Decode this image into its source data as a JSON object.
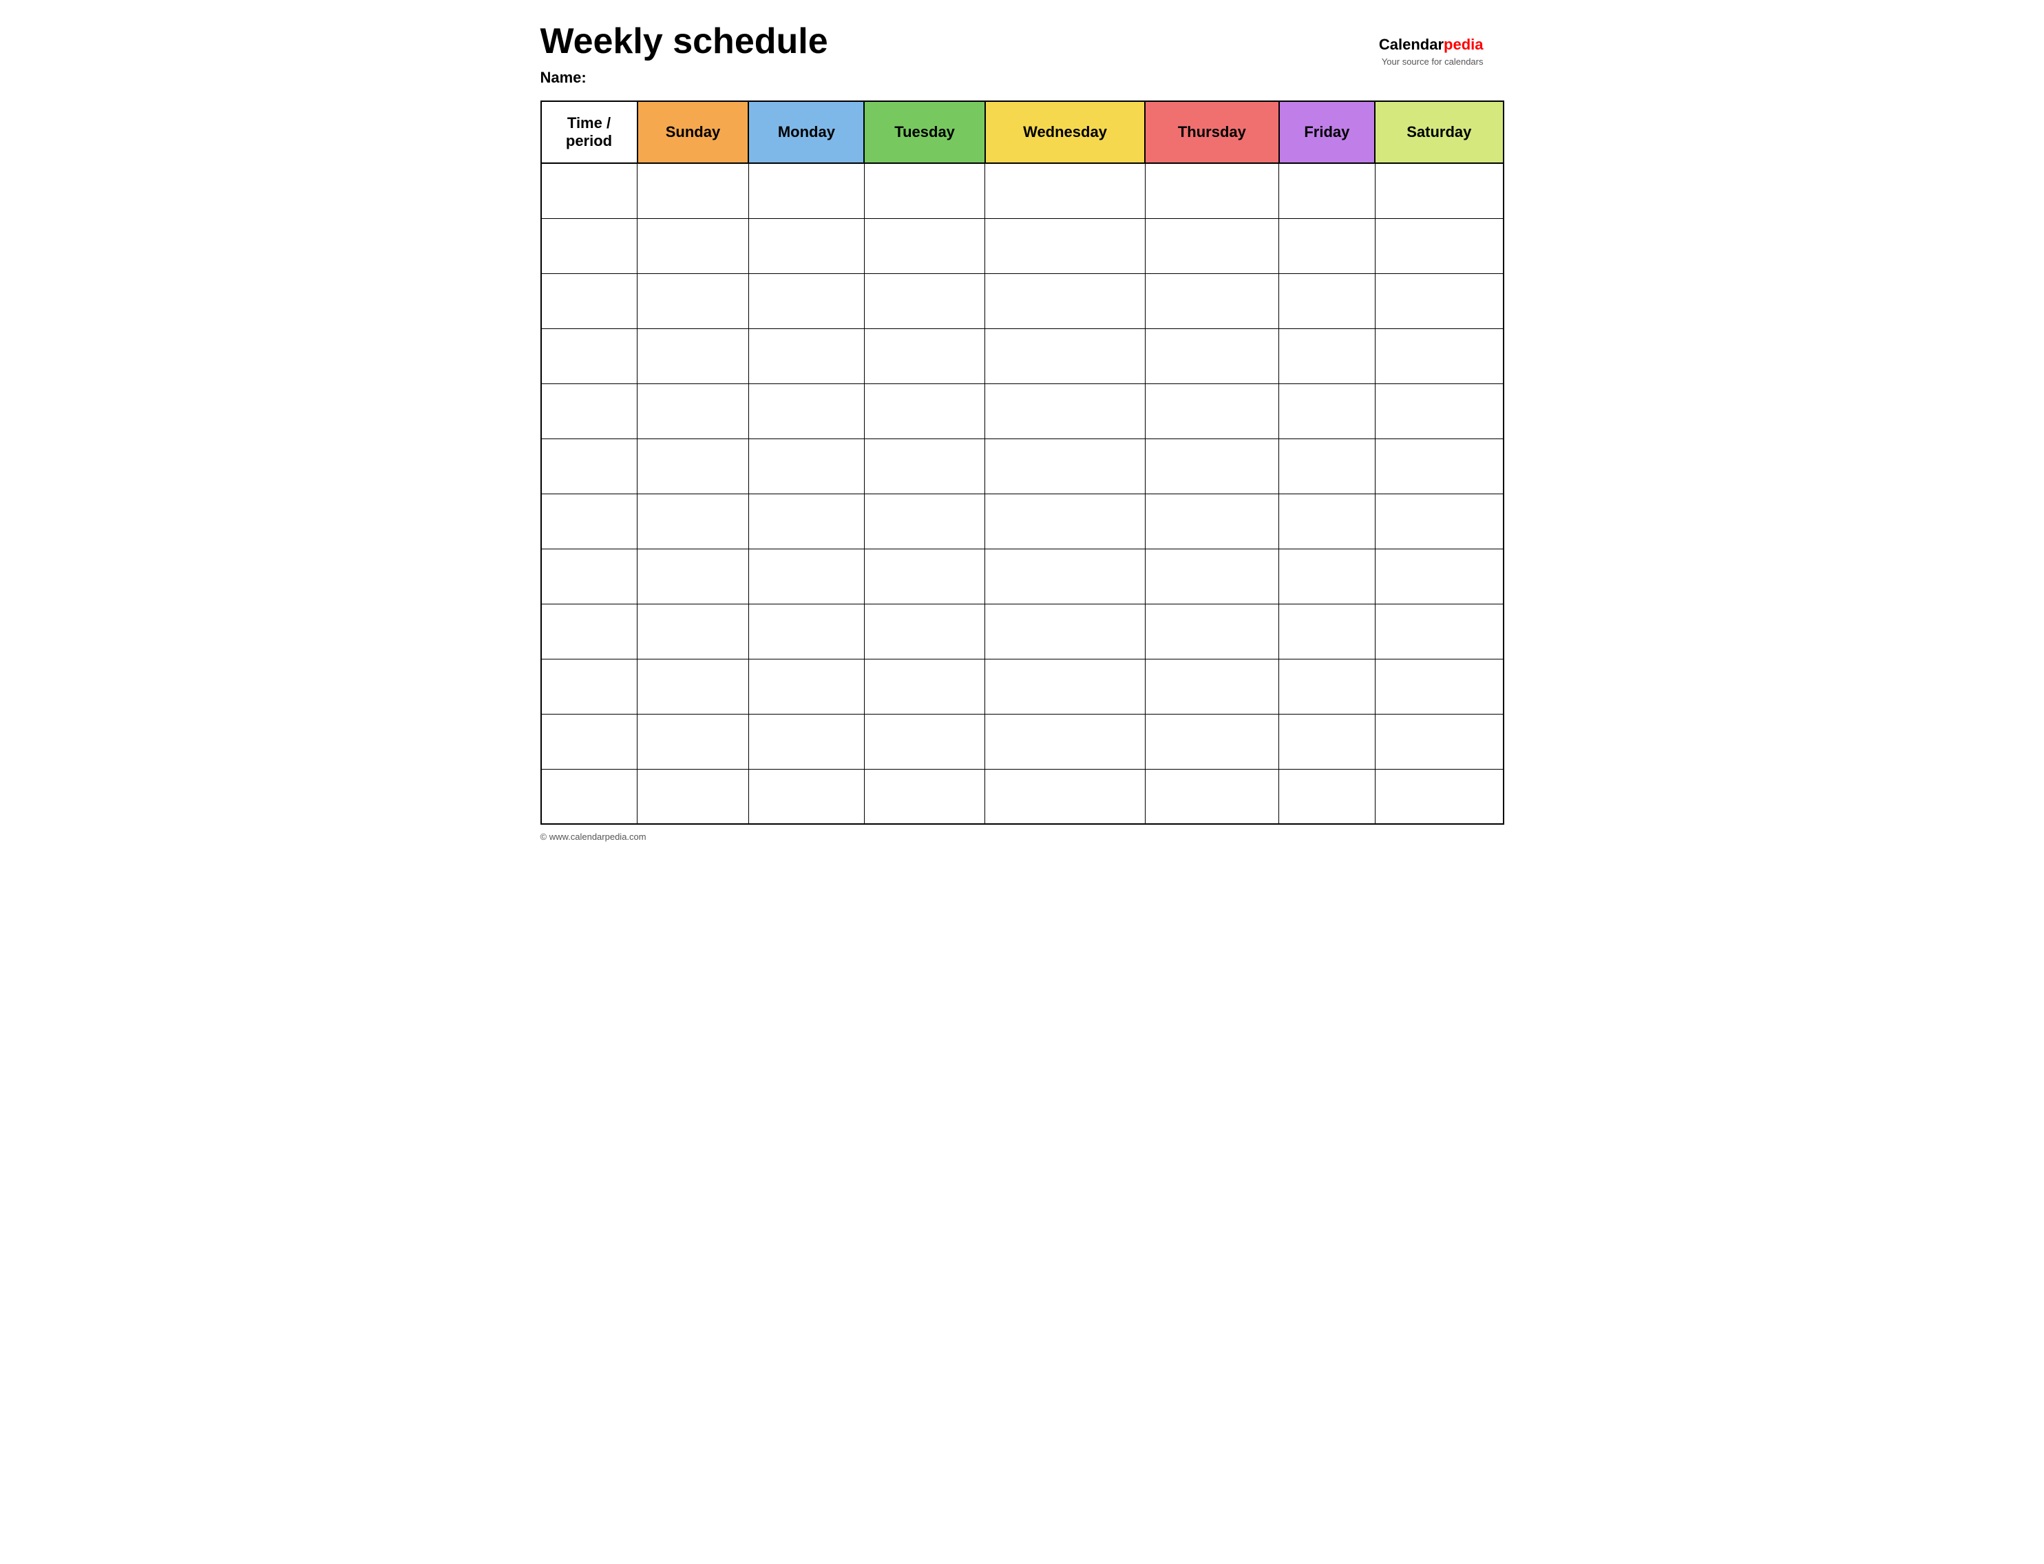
{
  "page": {
    "title": "Weekly schedule",
    "name_label": "Name:",
    "footer": "© www.calendarpedia.com"
  },
  "logo": {
    "brand_part1": "Calendar",
    "brand_part2": "pedia",
    "tagline": "Your source for calendars"
  },
  "table": {
    "headers": [
      {
        "id": "time",
        "label": "Time / period",
        "color_class": "col-time"
      },
      {
        "id": "sunday",
        "label": "Sunday",
        "color_class": "col-sunday"
      },
      {
        "id": "monday",
        "label": "Monday",
        "color_class": "col-monday"
      },
      {
        "id": "tuesday",
        "label": "Tuesday",
        "color_class": "col-tuesday"
      },
      {
        "id": "wednesday",
        "label": "Wednesday",
        "color_class": "col-wednesday"
      },
      {
        "id": "thursday",
        "label": "Thursday",
        "color_class": "col-thursday"
      },
      {
        "id": "friday",
        "label": "Friday",
        "color_class": "col-friday"
      },
      {
        "id": "saturday",
        "label": "Saturday",
        "color_class": "col-saturday"
      }
    ],
    "row_count": 12
  }
}
